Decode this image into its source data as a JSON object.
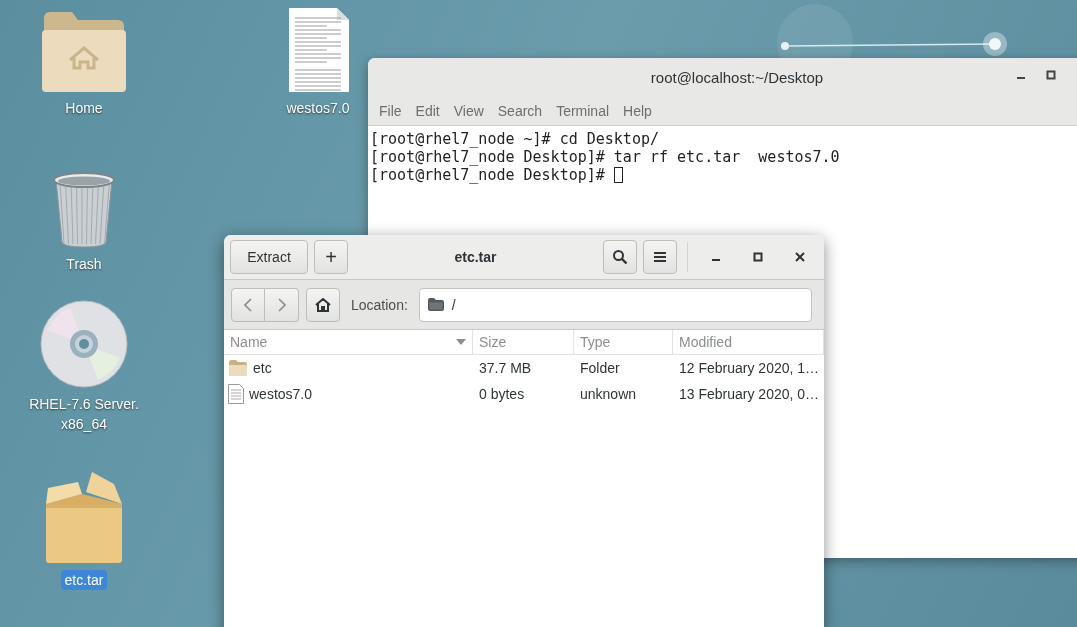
{
  "desktop_icons": [
    {
      "label": "Home",
      "kind": "home-folder",
      "selected": false
    },
    {
      "label": "westos7.0",
      "kind": "document",
      "selected": false
    },
    {
      "label": "Trash",
      "kind": "trash",
      "selected": false
    },
    {
      "label": "RHEL-7.6 Server. x86_64",
      "kind": "disc",
      "selected": false
    },
    {
      "label": "etc.tar",
      "kind": "archive",
      "selected": true
    }
  ],
  "terminal": {
    "title": "root@localhost:~/Desktop",
    "menu": [
      "File",
      "Edit",
      "View",
      "Search",
      "Terminal",
      "Help"
    ],
    "lines": [
      {
        "text": "[root@rhel7_node ~]# cd Desktop/",
        "cursor": false
      },
      {
        "text": "[root@rhel7_node Desktop]# tar rf etc.tar  westos7.0",
        "cursor": false
      },
      {
        "text": "[root@rhel7_node Desktop]# ",
        "cursor": true
      }
    ]
  },
  "archive": {
    "title": "etc.tar",
    "extract_button": "Extract",
    "add_button": "+",
    "location_label": "Location:",
    "location": "/",
    "columns": [
      {
        "label": "Name",
        "sorted": true
      },
      {
        "label": "Size",
        "sorted": false
      },
      {
        "label": "Type",
        "sorted": false
      },
      {
        "label": "Modified",
        "sorted": false
      }
    ],
    "rows": [
      {
        "kind": "folder",
        "name": "etc",
        "size": "37.7 MB",
        "type": "Folder",
        "modified": "12 February 2020, 1…"
      },
      {
        "kind": "file",
        "name": "westos7.0",
        "size": "0 bytes",
        "type": "unknown",
        "modified": "13 February 2020, 0…"
      }
    ]
  }
}
